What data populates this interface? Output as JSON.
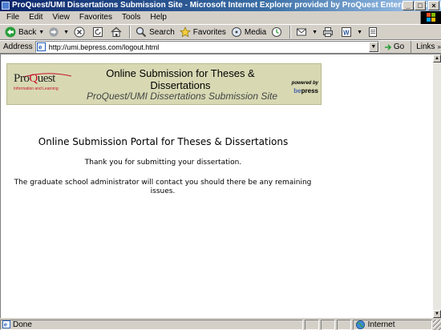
{
  "window": {
    "title": "ProQuest/UMI Dissertations Submission Site - Microsoft Internet Explorer provided by ProQuest Enterprise Services",
    "controls": [
      "_",
      "□",
      "×"
    ]
  },
  "menu": [
    "File",
    "Edit",
    "View",
    "Favorites",
    "Tools",
    "Help"
  ],
  "toolbar": {
    "back": "Back",
    "search": "Search",
    "favorites": "Favorites",
    "media": "Media"
  },
  "address": {
    "label": "Address",
    "url": "http://umi.bepress.com/logout.html",
    "go": "Go",
    "links": "Links"
  },
  "banner": {
    "logo_word": "ProQuest",
    "logo_tagline": "Information and Learning",
    "title": "Online Submission for Theses & Dissertations",
    "subtitle": "ProQuest/UMI Dissertations Submission Site",
    "powered_by": "powered by",
    "bepress": "bepress"
  },
  "page": {
    "heading": "Online Submission Portal for Theses & Dissertations",
    "thanks": "Thank you for submitting your dissertation.",
    "notice": "The graduate school administrator will contact you should there be any remaining issues."
  },
  "status": {
    "text": "Done",
    "zone": "Internet"
  },
  "colors": {
    "title_bar": "#0a246a",
    "chrome": "#d4d0c8",
    "banner_bg": "#d8d9b3",
    "proquest_red": "#c8102e"
  }
}
